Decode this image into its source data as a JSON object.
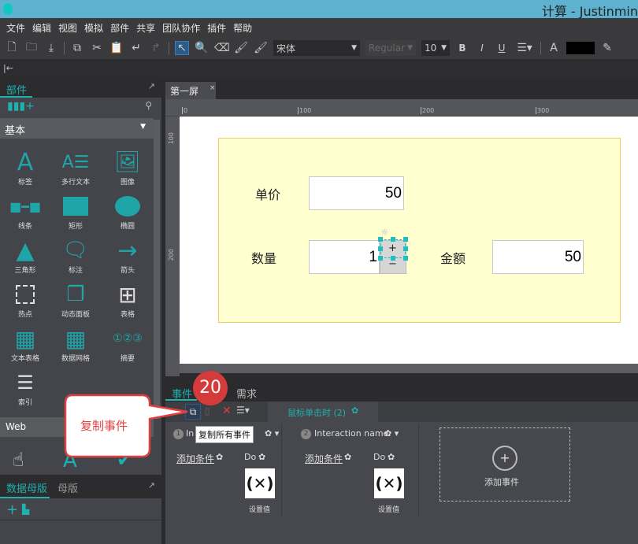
{
  "window": {
    "title": "计算 - Justinmin"
  },
  "menu": [
    "文件",
    "编辑",
    "视图",
    "模拟",
    "部件",
    "共享",
    "团队协作",
    "插件",
    "帮助"
  ],
  "toolbar": {
    "font": "宋体",
    "style": "Regular",
    "size": "10",
    "bold": "B",
    "italic": "I",
    "underline": "U",
    "font_color_label": "A"
  },
  "collapse_label": "|←",
  "widgets_panel": {
    "tab": "部件",
    "library": "基本",
    "items": [
      "标签",
      "多行文本",
      "图像",
      "线条",
      "矩形",
      "椭圆",
      "三角形",
      "标注",
      "箭头",
      "热点",
      "动态面板",
      "表格",
      "文本表格",
      "数据网格",
      "摘要",
      "索引"
    ],
    "web_section": "Web"
  },
  "masters_panel": {
    "tabs": [
      "数据母版",
      "母版"
    ]
  },
  "canvas": {
    "tab": "第一屏",
    "ruler_x": [
      "0",
      "100",
      "200",
      "300"
    ],
    "ruler_y": [
      "100",
      "200"
    ],
    "form": {
      "unit_price_label": "单价",
      "unit_price": "50",
      "qty_label": "数量",
      "qty": "1",
      "total_label": "金额",
      "total": "50",
      "plus": "+",
      "minus": "−"
    }
  },
  "events_panel": {
    "tabs": [
      "事件",
      "需求"
    ],
    "badge": "20",
    "event_tab": "鼠标单击时 (2)",
    "tooltip": "复制所有事件",
    "callout": "复制事件",
    "interactions": [
      {
        "num": "1",
        "name": "In",
        "cond": "添加条件",
        "do": "Do",
        "action": "设置值"
      },
      {
        "num": "2",
        "name": "Interaction name",
        "cond": "添加条件",
        "do": "Do",
        "action": "设置值"
      }
    ],
    "add_event": "添加事件"
  },
  "colors": {
    "accent": "#1fb0b0",
    "badge": "#d63b3b",
    "titlebar": "#5eb2cf"
  }
}
